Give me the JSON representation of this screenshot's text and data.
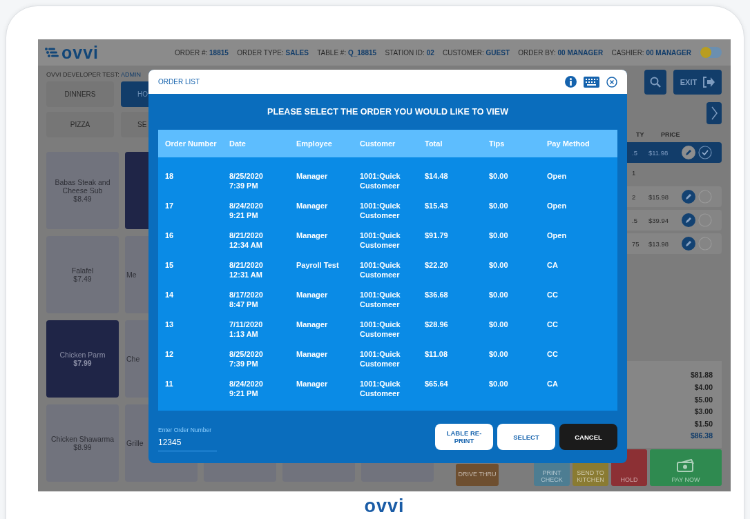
{
  "header": {
    "logo": "ovvi",
    "fields": [
      {
        "label": "ORDER #:",
        "value": "18815"
      },
      {
        "label": "ORDER TYPE:",
        "value": "SALES"
      },
      {
        "label": "TABLE #:",
        "value": "Q_18815"
      },
      {
        "label": "STATION ID:",
        "value": "02"
      },
      {
        "label": "CUSTOMER:",
        "value": "GUEST"
      },
      {
        "label": "ORDER BY:",
        "value": "00 MANAGER"
      },
      {
        "label": "CASHIER:",
        "value": "00 MANAGER"
      }
    ],
    "toggle": {
      "on": false
    }
  },
  "store": {
    "label": "OVVI DEVELOPER TEST:",
    "value": "ADMIN"
  },
  "categories": [
    {
      "label": "DINNERS",
      "selected": false,
      "kind": "full"
    },
    {
      "label": "HO",
      "selected": true,
      "kind": "cut"
    },
    {
      "label": "PIZZA",
      "selected": false,
      "kind": "full"
    },
    {
      "label": "SE",
      "selected": false,
      "kind": "cut"
    }
  ],
  "menu_rows": [
    [
      {
        "name": "Babas Steak and Cheese Sub",
        "price": "$8.49",
        "selected": false,
        "kind": "full"
      },
      {
        "selected": true,
        "kind": "cut"
      }
    ],
    [
      {
        "name": "Falafel",
        "price": "$7.49",
        "selected": false,
        "kind": "full"
      },
      {
        "name": "Me",
        "selected": false,
        "kind": "cut"
      }
    ],
    [
      {
        "name": "Chicken Parm",
        "price": "$7.99",
        "selected": true,
        "kind": "full"
      },
      {
        "name": "Che",
        "selected": false,
        "kind": "cut"
      }
    ],
    [
      {
        "name": "Chicken Shawarma",
        "price": "$8.99",
        "selected": false,
        "kind": "full"
      },
      {
        "name": "Grille",
        "selected": false,
        "kind": "cut"
      },
      {
        "selected": false,
        "kind": "cut"
      },
      {
        "selected": false,
        "kind": "cut"
      },
      {
        "selected": false,
        "kind": "cut"
      }
    ]
  ],
  "exit_button": {
    "label": "EXIT"
  },
  "order": {
    "columns": [
      "TY",
      "PRICE"
    ],
    "rows": [
      {
        "kind": "item",
        "qty": ".5",
        "price": "$11.98",
        "selected": true,
        "checked": true
      },
      {
        "kind": "modifier",
        "qty": "1"
      },
      {
        "kind": "item",
        "qty": "2",
        "price": "$15.98",
        "selected": false,
        "checked": false
      },
      {
        "kind": "item",
        "qty": ".5",
        "price": "$39.94",
        "selected": false,
        "checked": false
      },
      {
        "kind": "item",
        "qty": "75",
        "price": "$13.98",
        "selected": false,
        "checked": false
      }
    ]
  },
  "totals": [
    {
      "value": "$81.88",
      "kind": "line"
    },
    {
      "value": "$4.00",
      "kind": "line"
    },
    {
      "value": "$5.00",
      "kind": "line"
    },
    {
      "value": "$3.00",
      "kind": "line"
    },
    {
      "value": "$1.50",
      "kind": "line"
    },
    {
      "value": "$86.38",
      "kind": "total"
    }
  ],
  "actions": [
    {
      "label": "DRIVE THRU",
      "color": "#6e4f30",
      "kind": "plain"
    },
    {
      "label": "PRINT CHECK",
      "color": "#4d7d92",
      "kind": "plain"
    },
    {
      "label": "SEND TO KITCHEN",
      "color": "#8a7b32",
      "kind": "plain"
    },
    {
      "label": "HOLD",
      "color": "#8c3034",
      "kind": "plain"
    },
    {
      "label": "PAY NOW",
      "color": "#2f8a50",
      "kind": "pay"
    }
  ],
  "modal": {
    "title": "ORDER LIST",
    "prompt": "PLEASE SELECT THE ORDER YOU WOULD LIKE TO VIEW",
    "columns": [
      "Order Number",
      "Date",
      "Employee",
      "Customer",
      "Total",
      "Tips",
      "Pay Method"
    ],
    "rows": [
      [
        "18",
        "8/25/2020 7:39 PM",
        "Manager",
        "1001:Quick Customeer",
        "$14.48",
        "$0.00",
        "Open"
      ],
      [
        "17",
        "8/24/2020 9:21 PM",
        "Manager",
        "1001:Quick Customeer",
        "$15.43",
        "$0.00",
        "Open"
      ],
      [
        "16",
        "8/21/2020 12:34 AM",
        "Manager",
        "1001:Quick Customeer",
        "$91.79",
        "$0.00",
        "Open"
      ],
      [
        "15",
        "8/21/2020 12:31 AM",
        "Payroll Test",
        "1001:Quick Customeer",
        "$22.20",
        "$0.00",
        "CA"
      ],
      [
        "14",
        "8/17/2020 8:47 PM",
        "Manager",
        "1001:Quick Customeer",
        "$36.68",
        "$0.00",
        "CC"
      ],
      [
        "13",
        "7/11/2020 1:13 AM",
        "Manager",
        "1001:Quick Customeer",
        "$28.96",
        "$0.00",
        "CC"
      ],
      [
        "12",
        "8/25/2020 7:39 PM",
        "Manager",
        "1001:Quick Customeer",
        "$11.08",
        "$0.00",
        "CC"
      ],
      [
        "11",
        "8/24/2020 9:21 PM",
        "Manager",
        "1001:Quick Customeer",
        "$65.64",
        "$0.00",
        "CA"
      ]
    ],
    "input": {
      "label": "Enter Order Number",
      "value": "12345"
    },
    "buttons": [
      {
        "label": "LABLE RE-PRINT",
        "kind": "light"
      },
      {
        "label": "SELECT",
        "kind": "light"
      },
      {
        "label": "CANCEL",
        "kind": "dark"
      }
    ]
  },
  "footer_logo": "ovvi"
}
